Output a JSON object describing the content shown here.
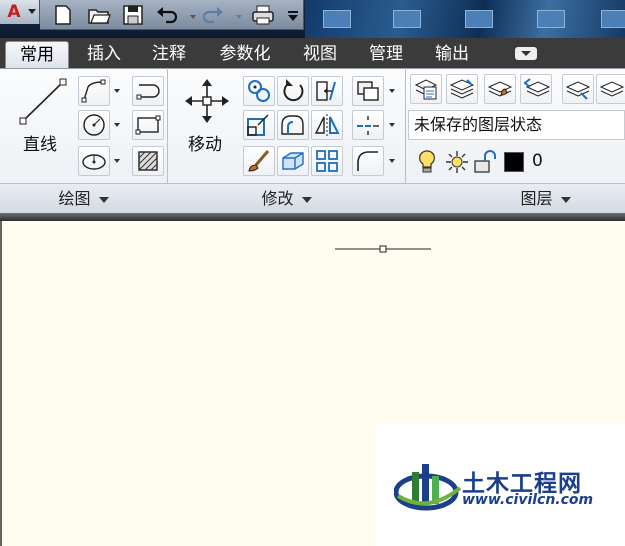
{
  "quick_access": {
    "app_menu_icon": "autocad-logo-icon",
    "buttons": [
      "new-file-icon",
      "open-folder-icon",
      "save-icon",
      "undo-icon",
      "redo-icon",
      "print-icon",
      "customize-icon"
    ]
  },
  "tabs": [
    {
      "label": "常用",
      "active": true
    },
    {
      "label": "插入",
      "active": false
    },
    {
      "label": "注释",
      "active": false
    },
    {
      "label": "参数化",
      "active": false
    },
    {
      "label": "视图",
      "active": false
    },
    {
      "label": "管理",
      "active": false
    },
    {
      "label": "输出",
      "active": false
    }
  ],
  "panels": {
    "draw": {
      "title": "绘图",
      "line_label": "直线"
    },
    "modify": {
      "title": "修改",
      "move_label": "移动"
    },
    "layers": {
      "title": "图层",
      "layer_state": "未保存的图层状态",
      "current_layer": "0",
      "layer_color": "#000000"
    }
  },
  "colors": {
    "canvas": "#fffcf0",
    "tab_bar": "#3b3b3b",
    "accent_blue": "#1f6fc1",
    "watermark_blue": "#1c3f8c"
  },
  "watermark": {
    "title": "土木工程网",
    "url": "www.civilcn.com"
  }
}
